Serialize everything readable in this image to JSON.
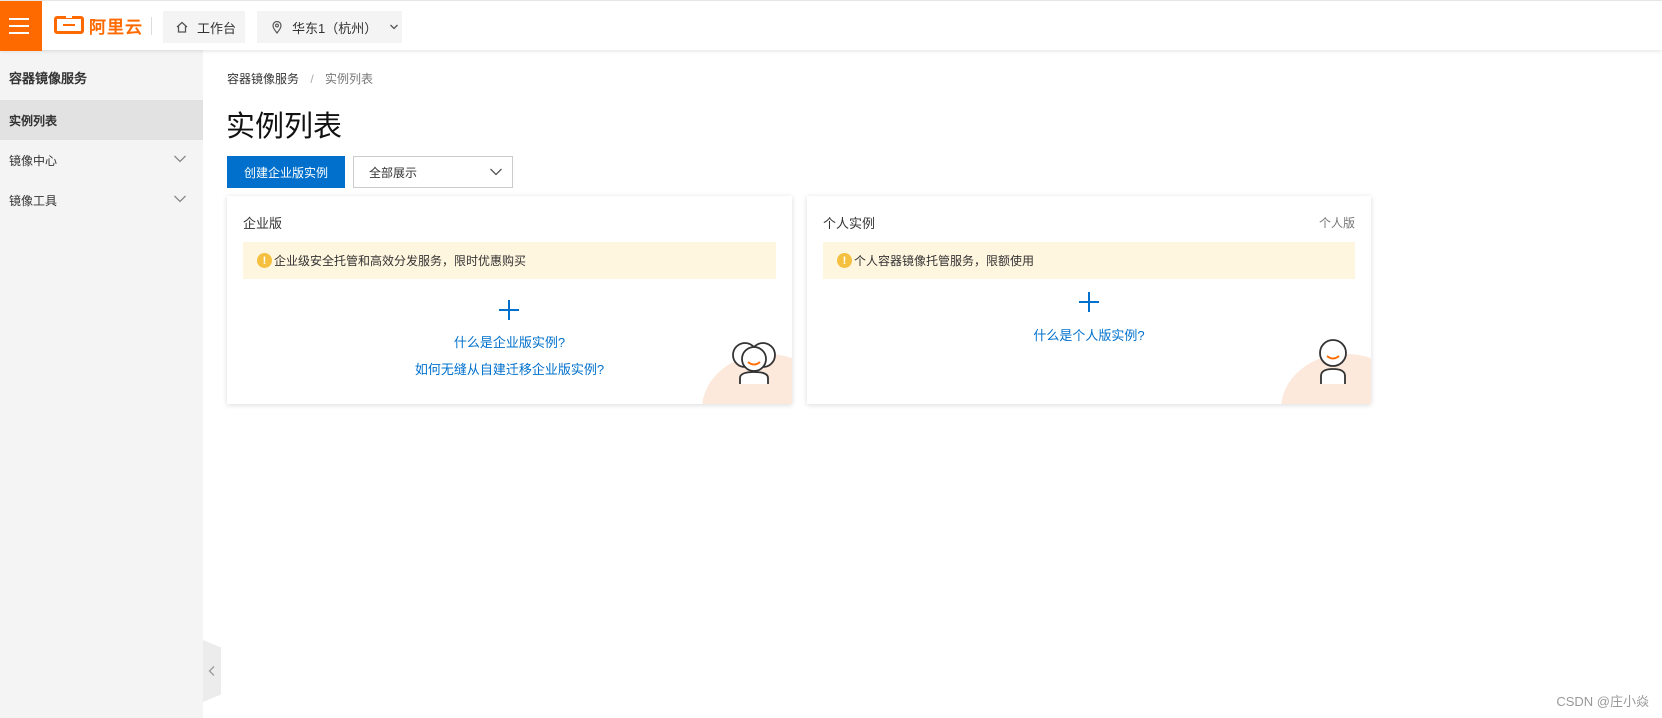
{
  "topbar": {
    "menu_icon": "hamburger-icon",
    "logo_text": "阿里云",
    "workbench_label": "工作台",
    "region_label": "华东1（杭州）"
  },
  "sidebar": {
    "title": "容器镜像服务",
    "items": [
      {
        "label": "实例列表",
        "active": true
      },
      {
        "label": "镜像中心",
        "expandable": true
      },
      {
        "label": "镜像工具",
        "expandable": true
      }
    ]
  },
  "breadcrumb": {
    "root": "容器镜像服务",
    "separator": "/",
    "current": "实例列表"
  },
  "page": {
    "title": "实例列表",
    "create_button": "创建企业版实例",
    "filter_select": "全部展示"
  },
  "cards": {
    "enterprise": {
      "title": "企业版",
      "notice": "企业级安全托管和高效分发服务，限时优惠购买",
      "link1": "什么是企业版实例?",
      "link2": "如何无缝从自建迁移企业版实例?"
    },
    "personal": {
      "title": "个人实例",
      "tag": "个人版",
      "notice": "个人容器镜像托管服务，限额使用",
      "link1": "什么是个人版实例?"
    }
  },
  "colors": {
    "brand": "#ff6a00",
    "primary": "#0070cc",
    "notice_bg": "#fff6df",
    "warn": "#f5c040"
  },
  "watermark": "CSDN @庄小焱"
}
